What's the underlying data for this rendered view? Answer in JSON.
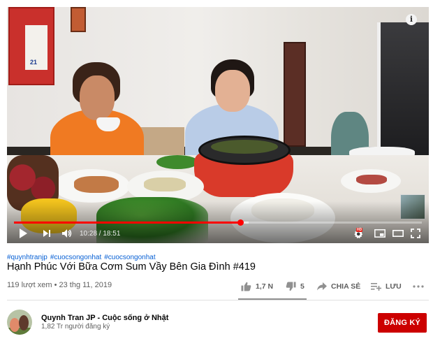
{
  "player": {
    "current_time": "10:28",
    "separator": " / ",
    "duration": "18:51",
    "progress_fraction": 0.555,
    "buffered_fraction": 0.575,
    "calendar_day": "21",
    "hd_badge": "HD",
    "info_icon_glyph": "i",
    "icons": [
      "play-icon",
      "next-icon",
      "volume-icon",
      "settings-icon",
      "miniplayer-icon",
      "theater-icon",
      "fullscreen-icon",
      "info-icon"
    ]
  },
  "video": {
    "hashtags": [
      "#quynhtranjp",
      "#cuocsongonhat",
      "#cuocsongonhat"
    ],
    "title": "Hạnh Phúc Với Bữa Cơm Sum Vầy Bên Gia Đình #419",
    "views": "119 lượt xem",
    "meta_separator": " • ",
    "date": "23 thg 11, 2019"
  },
  "actions": {
    "likes": "1,7 N",
    "dislikes": "5",
    "share": "CHIA SẺ",
    "save": "LƯU",
    "like_ratio": 0.997
  },
  "channel": {
    "name": "Quynh Tran JP - Cuộc sống ở Nhật",
    "subscribers": "1,82 Tr người đăng ký",
    "subscribe_label": "ĐĂNG KÝ"
  },
  "colors": {
    "accent_red": "#ff0000",
    "subscribe_red": "#cc0000",
    "hashtag_blue": "#065fd4",
    "secondary_text": "#606060"
  }
}
